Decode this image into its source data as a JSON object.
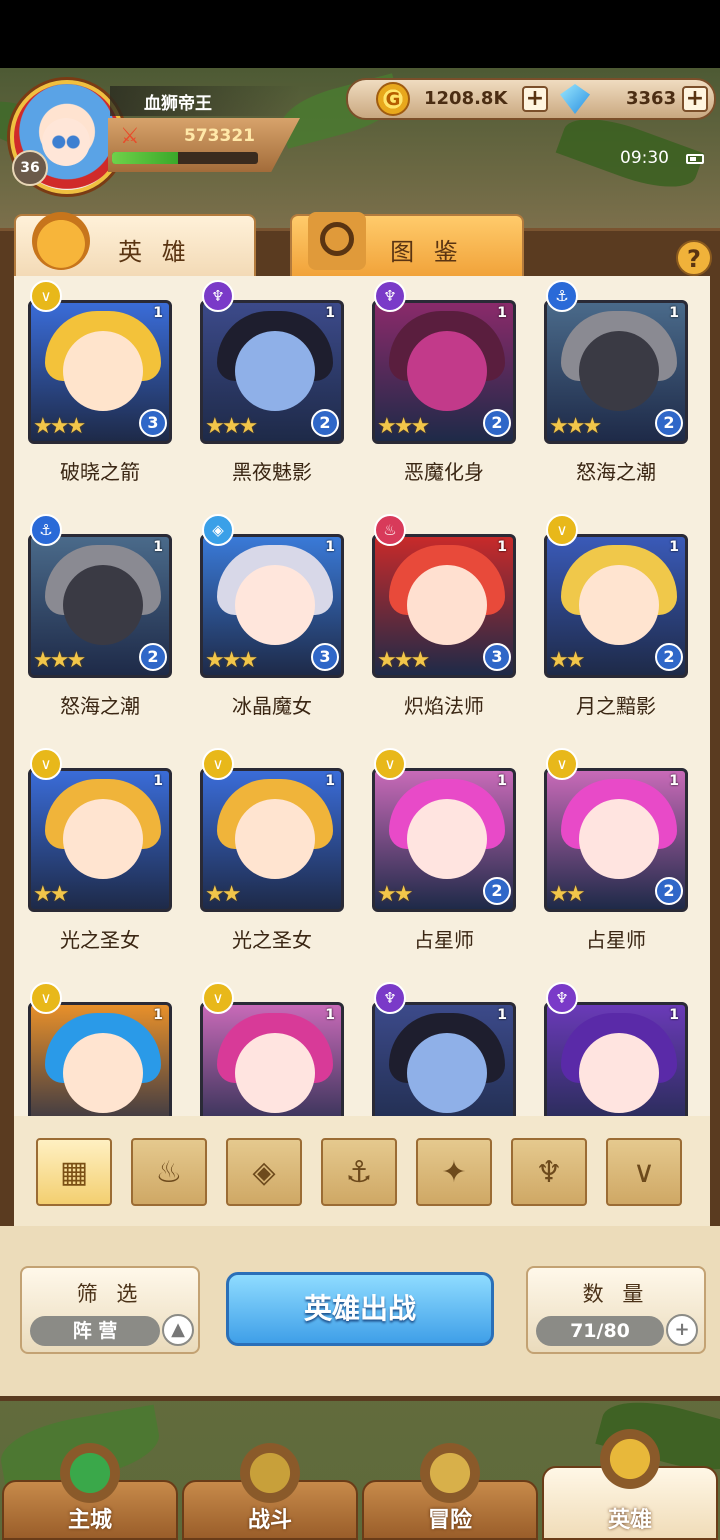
{
  "player": {
    "name": "血狮帝王",
    "level": "36",
    "power": "573321",
    "exp_fraction": 0.45
  },
  "currency": {
    "gold": "1208.8K",
    "gems": "3363"
  },
  "status": {
    "time": "09:30"
  },
  "tabs": {
    "hero": "英 雄",
    "codex": "图 鉴"
  },
  "help": "?",
  "heroes": [
    {
      "name": "破晓之箭",
      "faction": "light",
      "count": "1",
      "stars": 3,
      "rank": "3",
      "bg": "#3a6cd8",
      "hair": "#f3c23a",
      "face": "#ffe4cc"
    },
    {
      "name": "黑夜魅影",
      "faction": "dark",
      "count": "1",
      "stars": 3,
      "rank": "2",
      "bg": "#3c4a8a",
      "hair": "#1e1e2e",
      "face": "#8fb0e8"
    },
    {
      "name": "恶魔化身",
      "faction": "dark",
      "count": "1",
      "stars": 3,
      "rank": "2",
      "bg": "#8a2a6a",
      "hair": "#5a1e3e",
      "face": "#c23a8a"
    },
    {
      "name": "怒海之潮",
      "faction": "water",
      "count": "1",
      "stars": 3,
      "rank": "2",
      "bg": "#4a6a8a",
      "hair": "#8a8a92",
      "face": "#3a3a44"
    },
    {
      "name": "怒海之潮",
      "faction": "water",
      "count": "1",
      "stars": 3,
      "rank": "2",
      "bg": "#4a6a8a",
      "hair": "#8a8a92",
      "face": "#3a3a44"
    },
    {
      "name": "冰晶魔女",
      "faction": "ice",
      "count": "1",
      "stars": 3,
      "rank": "3",
      "bg": "#3a7ad8",
      "hair": "#d8d8e8",
      "face": "#ffe6dc"
    },
    {
      "name": "炽焰法师",
      "faction": "fire",
      "count": "1",
      "stars": 3,
      "rank": "3",
      "bg": "#c82a2a",
      "hair": "#e84a3a",
      "face": "#ffe0d0"
    },
    {
      "name": "月之黯影",
      "faction": "light",
      "count": "1",
      "stars": 2,
      "rank": "2",
      "bg": "#3a5ab8",
      "hair": "#f0c84a",
      "face": "#ffe4d0"
    },
    {
      "name": "光之圣女",
      "faction": "light",
      "count": "1",
      "stars": 2,
      "rank": "",
      "bg": "#3a6cd8",
      "hair": "#f0b43a",
      "face": "#ffe4d0"
    },
    {
      "name": "光之圣女",
      "faction": "light",
      "count": "1",
      "stars": 2,
      "rank": "",
      "bg": "#3a6cd8",
      "hair": "#f0b43a",
      "face": "#ffe4d0"
    },
    {
      "name": "占星师",
      "faction": "light",
      "count": "1",
      "stars": 2,
      "rank": "2",
      "bg": "#c86ab8",
      "hair": "#e84ac8",
      "face": "#ffe4e0"
    },
    {
      "name": "占星师",
      "faction": "light",
      "count": "1",
      "stars": 2,
      "rank": "2",
      "bg": "#c86ab8",
      "hair": "#e84ac8",
      "face": "#ffe4e0"
    },
    {
      "name": "",
      "faction": "light",
      "count": "1",
      "stars": 0,
      "rank": "",
      "bg": "#e8902a",
      "hair": "#2a9ae8",
      "face": "#ffe4d0"
    },
    {
      "name": "",
      "faction": "light",
      "count": "1",
      "stars": 0,
      "rank": "",
      "bg": "#c86ab8",
      "hair": "#d83a98",
      "face": "#ffe4e0"
    },
    {
      "name": "",
      "faction": "dark",
      "count": "1",
      "stars": 0,
      "rank": "",
      "bg": "#3c4a8a",
      "hair": "#1e1e2e",
      "face": "#8fb0e8"
    },
    {
      "name": "",
      "faction": "dark",
      "count": "1",
      "stars": 0,
      "rank": "",
      "bg": "#6a3ab8",
      "hair": "#5a2aa8",
      "face": "#ffe4e0"
    }
  ],
  "faction_styles": {
    "light": {
      "color": "#e8b81a",
      "glyph": "∨"
    },
    "dark": {
      "color": "#7a3ac8",
      "glyph": "♆"
    },
    "water": {
      "color": "#2a6ad8",
      "glyph": "⚓"
    },
    "ice": {
      "color": "#3aa0e8",
      "glyph": "◈"
    },
    "fire": {
      "color": "#d83a5a",
      "glyph": "♨"
    }
  },
  "filters": [
    {
      "name": "all",
      "glyph": "▦",
      "active": true
    },
    {
      "name": "fire",
      "glyph": "♨",
      "active": false
    },
    {
      "name": "ice",
      "glyph": "◈",
      "active": false
    },
    {
      "name": "water",
      "glyph": "⚓",
      "active": false
    },
    {
      "name": "beast",
      "glyph": "✦",
      "active": false
    },
    {
      "name": "dark",
      "glyph": "♆",
      "active": false
    },
    {
      "name": "light",
      "glyph": "∨",
      "active": false
    }
  ],
  "controls": {
    "filter_title": "筛 选",
    "filter_value": "阵 营",
    "deploy": "英雄出战",
    "count_title": "数 量",
    "count_value": "71/80"
  },
  "nav": [
    {
      "label": "主城",
      "active": false
    },
    {
      "label": "战斗",
      "active": false
    },
    {
      "label": "冒险",
      "active": false
    },
    {
      "label": "英雄",
      "active": true
    }
  ]
}
